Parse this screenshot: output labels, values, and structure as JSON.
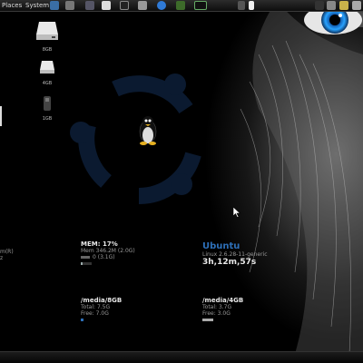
{
  "top_panel": {
    "menus": [
      "Places",
      "System"
    ]
  },
  "drives": [
    {
      "label": "8GB",
      "icon": "drive-icon"
    },
    {
      "label": "4GB",
      "icon": "drive-icon"
    },
    {
      "label": "1GB",
      "icon": "usb-drive-icon"
    }
  ],
  "conky_left_partial": [
    "m(R)",
    "z"
  ],
  "memory": {
    "title": "MEM: 17%",
    "line": "Mem 346.2M (2.0G)",
    "swap": "0 (3.1G)",
    "usage_fraction": 0.17
  },
  "system": {
    "os": "Ubuntu",
    "kernel": "Linux 2.6.28-11-generic",
    "uptime": "3h,12m,57s"
  },
  "media": [
    {
      "mount": "/media/8GB",
      "total": "Total: 7.5G",
      "free": "Free: 7.0G",
      "used_fraction": 0.07
    },
    {
      "mount": "/media/4GB",
      "total": "Total: 3.7G",
      "free": "Free: 3.0G",
      "used_fraction": 0.19
    }
  ],
  "colors": {
    "accent": "#2d6fb8",
    "logo": "#0b1a30",
    "eye": "#29a3ff"
  }
}
